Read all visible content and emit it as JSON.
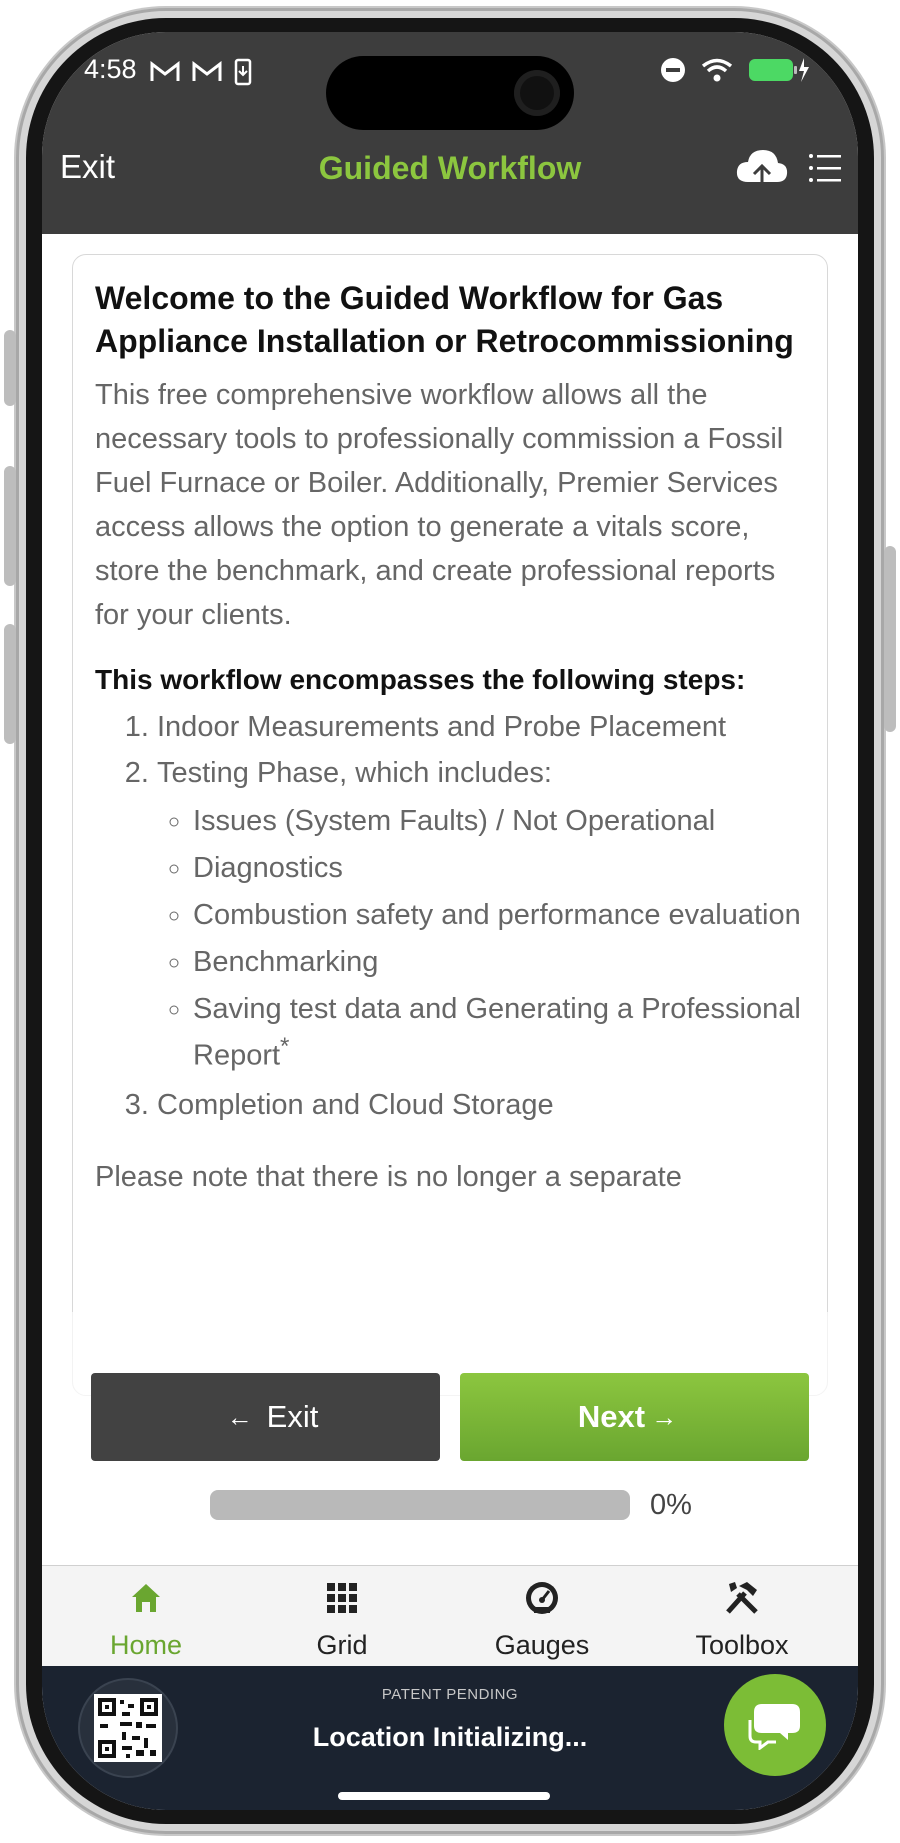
{
  "status_bar": {
    "time": "4:58"
  },
  "nav": {
    "exit_label": "Exit",
    "title": "Guided Workflow"
  },
  "card": {
    "title": "Welcome to the Guided Workflow for Gas Appliance Installation or Retrocommissioning",
    "intro": "This free comprehensive workflow allows all the necessary tools to professionally commission a Fossil Fuel Furnace or Boiler. Additionally, Premier Services access allows the option to generate a vitals score, store the benchmark, and create professional reports for your clients.",
    "steps_heading": "This workflow encompasses the following steps:",
    "steps": [
      "Indoor Measurements and Probe Placement",
      "Testing Phase, which includes:",
      "Completion and Cloud Storage"
    ],
    "substeps": [
      "Issues (System Faults) / Not Operational",
      "Diagnostics",
      "Combustion safety and performance evaluation",
      "Benchmarking",
      "Saving test data and Generating a Professional Report"
    ],
    "footnote_mark": "*",
    "note": "Please note that there is no longer a separate"
  },
  "buttons": {
    "exit_label": "Exit",
    "next_label": "Next"
  },
  "progress": {
    "value": 0,
    "label": "0%"
  },
  "tabs": [
    {
      "label": "Home",
      "icon": "home-icon"
    },
    {
      "label": "Grid",
      "icon": "grid-icon"
    },
    {
      "label": "Gauges",
      "icon": "gauge-icon"
    },
    {
      "label": "Toolbox",
      "icon": "toolbox-icon"
    }
  ],
  "footer": {
    "patent": "PATENT PENDING",
    "location_status": "Location Initializing..."
  },
  "colors": {
    "accent": "#8cc63f",
    "header_bg": "#3d3d3d",
    "footer_bg": "#1b2330"
  }
}
